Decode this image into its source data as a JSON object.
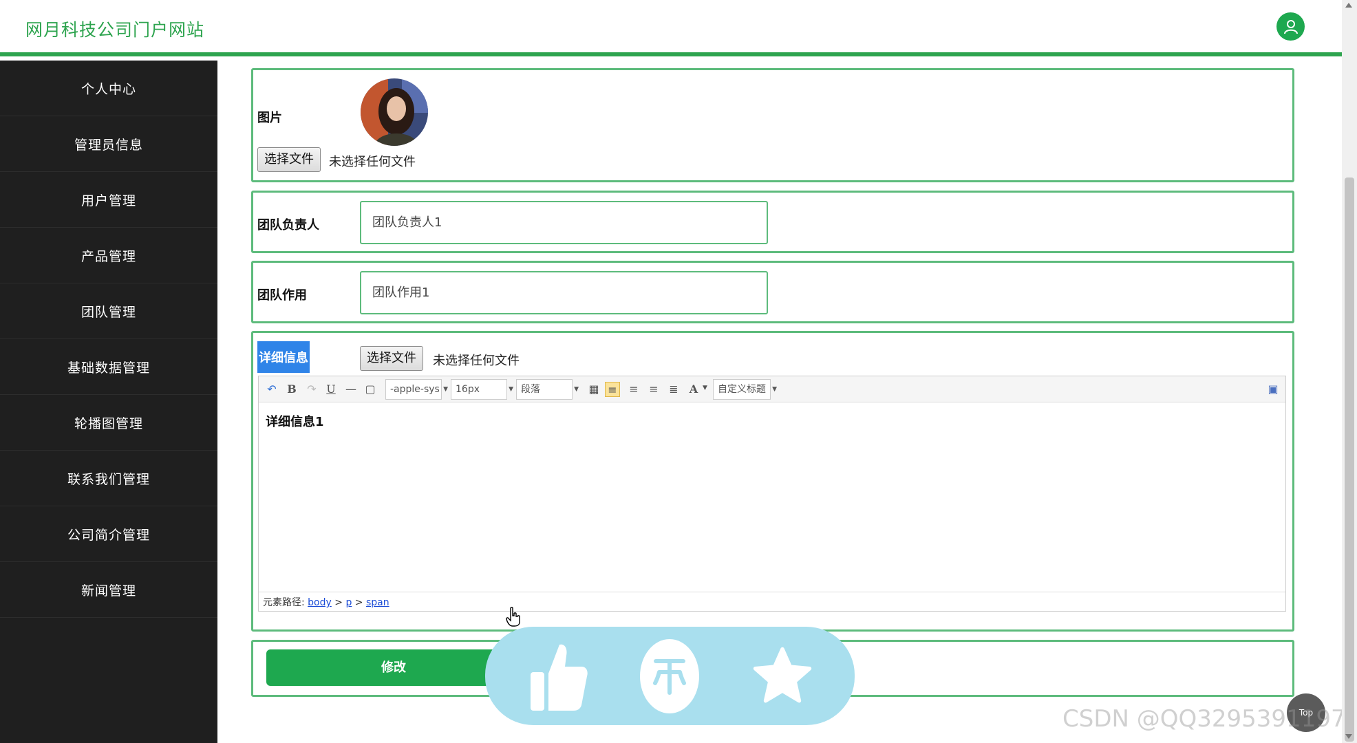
{
  "header": {
    "title": "网月科技公司门户网站"
  },
  "sidebar": {
    "items": [
      {
        "label": "个人中心"
      },
      {
        "label": "管理员信息"
      },
      {
        "label": "用户管理"
      },
      {
        "label": "产品管理"
      },
      {
        "label": "团队管理"
      },
      {
        "label": "基础数据管理"
      },
      {
        "label": "轮播图管理"
      },
      {
        "label": "联系我们管理"
      },
      {
        "label": "公司简介管理"
      },
      {
        "label": "新闻管理"
      }
    ]
  },
  "form": {
    "image": {
      "label": "图片",
      "file_button": "选择文件",
      "file_status": "未选择任何文件"
    },
    "leader": {
      "label": "团队负责人",
      "value": "团队负责人1"
    },
    "purpose": {
      "label": "团队作用",
      "value": "团队作用1"
    },
    "detail": {
      "label": "详细信息",
      "file_button": "选择文件",
      "file_status": "未选择任何文件",
      "toolbar": {
        "font_family": "-apple-sys",
        "font_size": "16px",
        "paragraph": "段落",
        "custom_title": "自定义标题"
      },
      "content": "详细信息1",
      "path_label": "元素路径:",
      "path": [
        "body",
        "p",
        "span"
      ]
    },
    "submit_label": "修改"
  },
  "top_button": "Top",
  "watermark": "CSDN @QQ3295391197",
  "colors": {
    "accent": "#1ea84f",
    "sidebar": "#1f1f1f",
    "widget": "#a9dfee"
  }
}
